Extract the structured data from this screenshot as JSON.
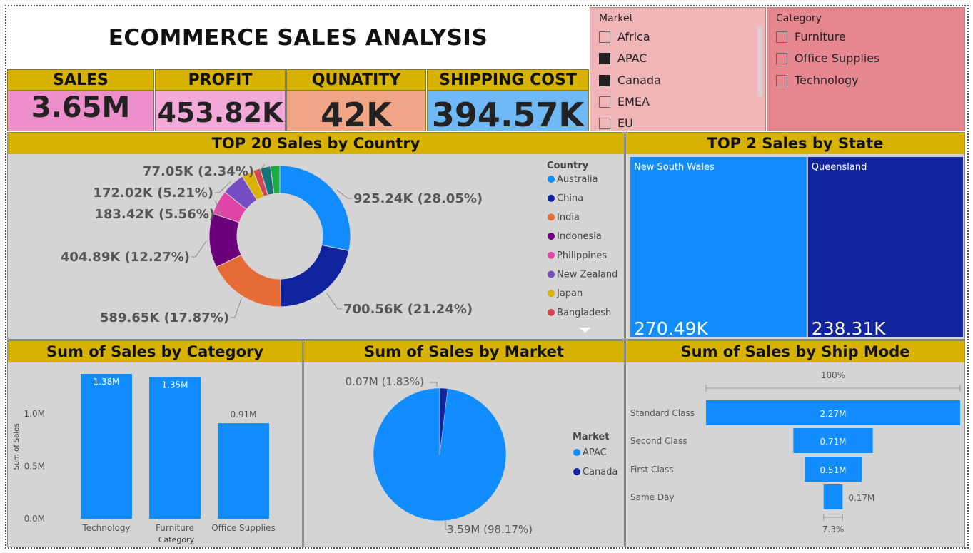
{
  "header": {
    "title": "ECOMMERCE SALES ANALYSIS"
  },
  "kpis": [
    {
      "label": "SALES",
      "value": "3.65M"
    },
    {
      "label": "PROFIT",
      "value": "453.82K"
    },
    {
      "label": "QUNATITY",
      "value": "42K"
    },
    {
      "label": "SHIPPING COST",
      "value": "394.57K"
    }
  ],
  "slicers": {
    "market": {
      "title": "Market",
      "items": [
        {
          "label": "Africa",
          "checked": false
        },
        {
          "label": "APAC",
          "checked": true
        },
        {
          "label": "Canada",
          "checked": true
        },
        {
          "label": "EMEA",
          "checked": false
        },
        {
          "label": "EU",
          "checked": false
        }
      ]
    },
    "category": {
      "title": "Category",
      "items": [
        {
          "label": "Furniture",
          "checked": false
        },
        {
          "label": "Office Supplies",
          "checked": false
        },
        {
          "label": "Technology",
          "checked": false
        }
      ]
    }
  },
  "colors": {
    "kpi_sales": "#ec8fcb",
    "kpi_profit": "#f3aad8",
    "kpi_quantity": "#f0a587",
    "kpi_shipping": "#6fb9f7",
    "header_gold": "#d8b200",
    "blue": "#118dff",
    "navy": "#12239e",
    "slicer_market": "#efb5b7",
    "slicer_category": "#e6878f"
  },
  "chart_data": [
    {
      "type": "pie",
      "title": "TOP 20 Sales by Country",
      "legend_title": "Country",
      "legend_position": "right",
      "legend": [
        {
          "name": "Australia",
          "color": "#118dff"
        },
        {
          "name": "China",
          "color": "#12239e"
        },
        {
          "name": "India",
          "color": "#e66c37"
        },
        {
          "name": "Indonesia",
          "color": "#6b007b"
        },
        {
          "name": "Philippines",
          "color": "#e044a7"
        },
        {
          "name": "New Zealand",
          "color": "#744ec2"
        },
        {
          "name": "Japan",
          "color": "#d9b300"
        },
        {
          "name": "Bangladesh",
          "color": "#d64550"
        }
      ],
      "slices": [
        {
          "value": 925.24,
          "percent": 28.05,
          "label": "925.24K (28.05%)",
          "color": "#118dff"
        },
        {
          "value": 700.56,
          "percent": 21.24,
          "label": "700.56K (21.24%)",
          "color": "#12239e"
        },
        {
          "value": 589.65,
          "percent": 17.87,
          "label": "589.65K (17.87%)",
          "color": "#e66c37"
        },
        {
          "value": 404.89,
          "percent": 12.27,
          "label": "404.89K (12.27%)",
          "color": "#6b007b"
        },
        {
          "value": 183.42,
          "percent": 5.56,
          "label": "183.42K (5.56%)",
          "color": "#e044a7"
        },
        {
          "value": 172.02,
          "percent": 5.21,
          "label": "172.02K (5.21%)",
          "color": "#744ec2"
        },
        {
          "value": 90,
          "percent": 2.73,
          "label": "",
          "color": "#d9b300"
        },
        {
          "value": 55,
          "percent": 1.67,
          "label": "",
          "color": "#d64550"
        },
        {
          "value": 77.05,
          "percent": 2.34,
          "label": "77.05K (2.34%)",
          "color": "#197278"
        },
        {
          "value": 70,
          "percent": 2.12,
          "label": "",
          "color": "#1aab40"
        }
      ]
    },
    {
      "type": "treemap",
      "title": "TOP 2 Sales by State",
      "items": [
        {
          "name": "New South Wales",
          "value": 270.49,
          "label": "270.49K",
          "color": "#118dff"
        },
        {
          "name": "Queensland",
          "value": 238.31,
          "label": "238.31K",
          "color": "#12239e"
        }
      ]
    },
    {
      "type": "bar",
      "title": "Sum of Sales by Category",
      "categories": [
        "Technology",
        "Furniture",
        "Office Supplies"
      ],
      "values": [
        1.38,
        1.35,
        0.91
      ],
      "value_labels": [
        "1.38M",
        "1.35M",
        "0.91M"
      ],
      "xlabel": "Category",
      "ylabel": "Sum of Sales",
      "yticks": [
        "0.0M",
        "0.5M",
        "1.0M"
      ],
      "ylim": [
        0,
        1.38
      ]
    },
    {
      "type": "pie",
      "title": "Sum of Sales by Market",
      "legend_title": "Market",
      "legend_position": "right",
      "slices": [
        {
          "name": "APAC",
          "value": 3.59,
          "percent": 98.17,
          "label": "3.59M (98.17%)",
          "color": "#118dff"
        },
        {
          "name": "Canada",
          "value": 0.07,
          "percent": 1.83,
          "label": "0.07M (1.83%)",
          "color": "#12239e"
        }
      ]
    },
    {
      "type": "funnel",
      "title": "Sum of Sales by Ship Mode",
      "top_percent_label": "100%",
      "bottom_percent_label": "7.3%",
      "categories": [
        "Standard Class",
        "Second Class",
        "First Class",
        "Same Day"
      ],
      "values": [
        2.27,
        0.71,
        0.51,
        0.17
      ],
      "value_labels": [
        "2.27M",
        "0.71M",
        "0.51M",
        "0.17M"
      ]
    }
  ]
}
